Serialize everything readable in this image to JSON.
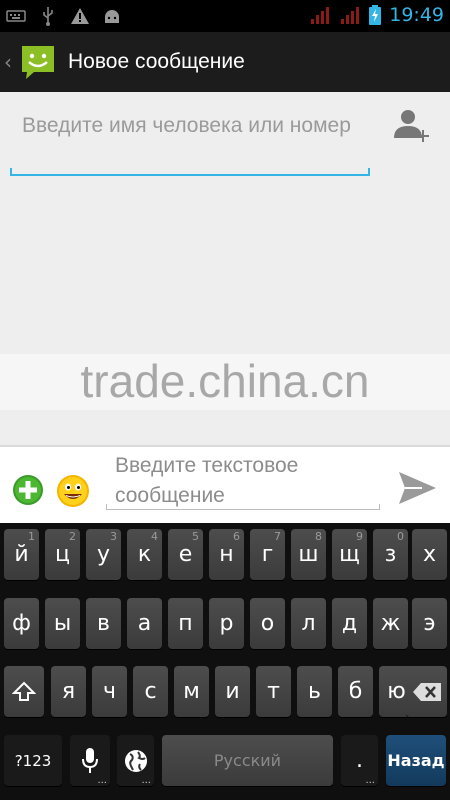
{
  "status_bar": {
    "icons": [
      "keyboard-icon",
      "usb-icon",
      "warning-icon",
      "android-icon"
    ],
    "right_icons": [
      "signal-1-icon",
      "signal-2-icon",
      "battery-charging-icon"
    ],
    "time": "19:49",
    "time_color": "#33b5e5"
  },
  "action_bar": {
    "title": "Новое сообщение",
    "icon": "messaging-smiley-icon",
    "back_glyph": "‹"
  },
  "recipient": {
    "placeholder": "Введите имя человека или номер",
    "add_contact_icon": "add-contact-icon"
  },
  "watermark": {
    "text": "trade.china.cn"
  },
  "compose": {
    "placeholder": "Введите текстовое сообщение",
    "attach_icon": "add-attachment-icon",
    "emoji_icon": "smiley-icon",
    "send_icon": "send-icon"
  },
  "keyboard": {
    "row1": [
      {
        "label": "й",
        "hint": "1"
      },
      {
        "label": "ц",
        "hint": "2"
      },
      {
        "label": "у",
        "hint": "3"
      },
      {
        "label": "к",
        "hint": "4"
      },
      {
        "label": "е",
        "hint": "5"
      },
      {
        "label": "н",
        "hint": "6"
      },
      {
        "label": "г",
        "hint": "7"
      },
      {
        "label": "ш",
        "hint": "8"
      },
      {
        "label": "щ",
        "hint": "9"
      },
      {
        "label": "з",
        "hint": "0"
      },
      {
        "label": "х",
        "hint": ""
      }
    ],
    "row2": [
      "ф",
      "ы",
      "в",
      "а",
      "п",
      "р",
      "о",
      "л",
      "д",
      "ж",
      "э"
    ],
    "row3": [
      "я",
      "ч",
      "с",
      "м",
      "и",
      "т",
      "ь",
      "б",
      "ю"
    ],
    "shift_icon": "shift-icon",
    "backspace_icon": "backspace-icon",
    "symbols_label": "?123",
    "mic_icon": "microphone-icon",
    "globe_icon": "globe-icon",
    "space_label": "Русский",
    "period_label": ".",
    "enter_label": "Назад",
    "enter_color": "#1f4f7a"
  }
}
